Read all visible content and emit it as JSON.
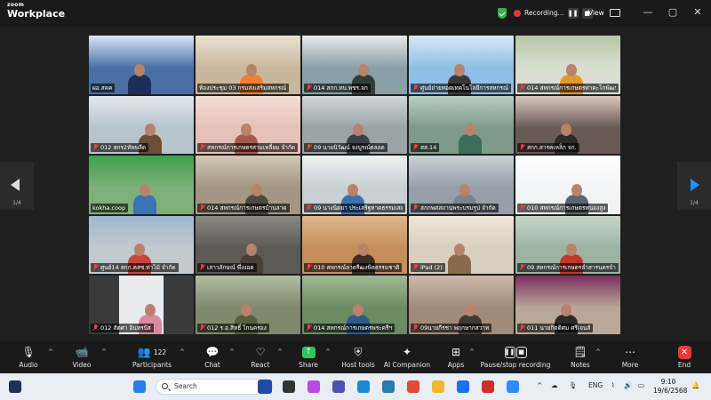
{
  "app": {
    "brand_top": "zoom",
    "brand_bottom": "Workplace"
  },
  "titlebar": {
    "recording_label": "Recording...",
    "view_label": "View",
    "pause_glyph": "❚❚",
    "stop_glyph": "■"
  },
  "window_controls": {
    "minimize": "—",
    "maximize": "▢",
    "close": "✕"
  },
  "pagination": {
    "left": "1/4",
    "right": "1/4"
  },
  "tiles": [
    {
      "name": "ผอ.สคค",
      "muted": false,
      "bg": "#4a6fa5",
      "accent": "#d7e6f5",
      "body": "#1c2f5a"
    },
    {
      "name": "ห้องประชุม 03 กรมส่งเสริมสหกรณ์",
      "muted": false,
      "bg": "#c9b79c",
      "accent": "#e9e2d4",
      "body": "#f08030",
      "active": true
    },
    {
      "name": "014 สกก.ทบ.พชร.จก",
      "muted": true,
      "bg": "#8aa0a8",
      "accent": "#e8e8e8",
      "body": "#2f3d3a"
    },
    {
      "name": "ศูนย์ถ่ายทอดเทคโนโลยีการสหกรณ์",
      "muted": true,
      "bg": "#8fbfe4",
      "accent": "#d6e9f7",
      "body": "#3a3a3a"
    },
    {
      "name": "014 สหกรณ์การเกษตรท่าตะโกพัฒนา",
      "muted": true,
      "bg": "#d8dfd0",
      "accent": "#b7c7a8",
      "body": "#e29a2d"
    },
    {
      "name": "012 สกร2ทัพพลีด",
      "muted": true,
      "bg": "#b8c4cc",
      "accent": "#e3e9ee",
      "body": "#6a4e35"
    },
    {
      "name": "สหกรณ์การเกษตรสามเหลี่ยม จำกัด",
      "muted": true,
      "bg": "#e6c1b8",
      "accent": "#f2ded8",
      "body": "#a85a4a"
    },
    {
      "name": "09 นายนิวัฒน์ จงบูรณ์ดลอด",
      "muted": true,
      "bg": "#9aa4a8",
      "accent": "#cfd7da",
      "body": "#3b4246"
    },
    {
      "name": "สส.14",
      "muted": true,
      "bg": "#7e9a8a",
      "accent": "#b9cfc2",
      "body": "#3c6e5a"
    },
    {
      "name": "สกก.สารคเหล็ก จก.",
      "muted": true,
      "bg": "#6a5a55",
      "accent": "#d8c6be",
      "body": "#2d2a2a"
    },
    {
      "name": "kokha.coop",
      "muted": false,
      "bg": "#7eb07a",
      "accent": "#3da14a",
      "body": "#3b73b5"
    },
    {
      "name": "014 สหกรณ์การเกษตรบ้านลาด",
      "muted": true,
      "bg": "#a39682",
      "accent": "#d1c7b6",
      "body": "#4d4a40"
    },
    {
      "name": "09 นางนิตยา ประเสริฐทาดธรรมเสมอ",
      "muted": true,
      "bg": "#c8d0d4",
      "accent": "#eef2f4",
      "body": "#3e6fb0"
    },
    {
      "name": "สกกพศสถานพระบรมรูป จำกัด",
      "muted": true,
      "bg": "#95a0a8",
      "accent": "#c9d1d6",
      "body": "#7c8489"
    },
    {
      "name": "010 สหกรณ์การเกษตรหนองสูง",
      "muted": true,
      "bg": "#f1f3f5",
      "accent": "#ffffff",
      "body": "#5a6470"
    },
    {
      "name": "ศูนย์14 สกก.คสช.ท่าไม้ จำกัด",
      "muted": true,
      "bg": "#c2c9cf",
      "accent": "#9fb7cf",
      "body": "#c8463d"
    },
    {
      "name": "เสาวลักษณ์ พึ่งงอด",
      "muted": true,
      "bg": "#5c5a55",
      "accent": "#8d8a82",
      "body": "#4a4038"
    },
    {
      "name": "010 สหกรณ์ลาดรีฒงพิลธรรมชาติ",
      "muted": true,
      "bg": "#c58f5c",
      "accent": "#e0b78d",
      "body": "#3c2e25"
    },
    {
      "name": "iPad (2)",
      "muted": true,
      "bg": "#d8cfc0",
      "accent": "#efe7db",
      "body": "#8a6a4a"
    },
    {
      "name": "09 สหกรณ์การเกษตรลำสารนครจำกัด",
      "muted": true,
      "bg": "#9db3a2",
      "accent": "#c7d7c9",
      "body": "#c0392b"
    },
    {
      "name": "012 สัตศา อินทรปัส",
      "muted": true,
      "bg": "#3a3a3a",
      "accent": "#e9ecef",
      "body": "#d98aa0",
      "inset": true
    },
    {
      "name": "012 ร.อ.สิทธิ์ ไกนครอง",
      "muted": true,
      "bg": "#7f8a6d",
      "accent": "#b3bda1",
      "body": "#55603f"
    },
    {
      "name": "014 สหกรณ์การเกษตรพระครีฯ",
      "muted": true,
      "bg": "#6c8b64",
      "accent": "#9fb996",
      "body": "#2f5a8a"
    },
    {
      "name": "09นายกีรชา พฤกษากสวาท",
      "muted": true,
      "bg": "#a08a7a",
      "accent": "#cdb8aa",
      "body": "#403a36"
    },
    {
      "name": "011 นายกิตติศม ศรีเจนส์",
      "muted": true,
      "bg": "#b9a89a",
      "accent": "#7a2f5e",
      "body": "#2a2a2a"
    }
  ],
  "toolbar": {
    "audio": "Audio",
    "video": "Video",
    "participants": "Participants",
    "participants_count": "122",
    "chat": "Chat",
    "react": "React",
    "share": "Share",
    "host_tools": "Host tools",
    "ai_companion": "AI Companion",
    "apps": "Apps",
    "recording": "Pause/stop recording",
    "notes": "Notes",
    "more": "More",
    "end": "End"
  },
  "taskbar": {
    "search_placeholder": "Search",
    "language": "ENG",
    "time": "9:10",
    "date": "19/6/2568"
  }
}
